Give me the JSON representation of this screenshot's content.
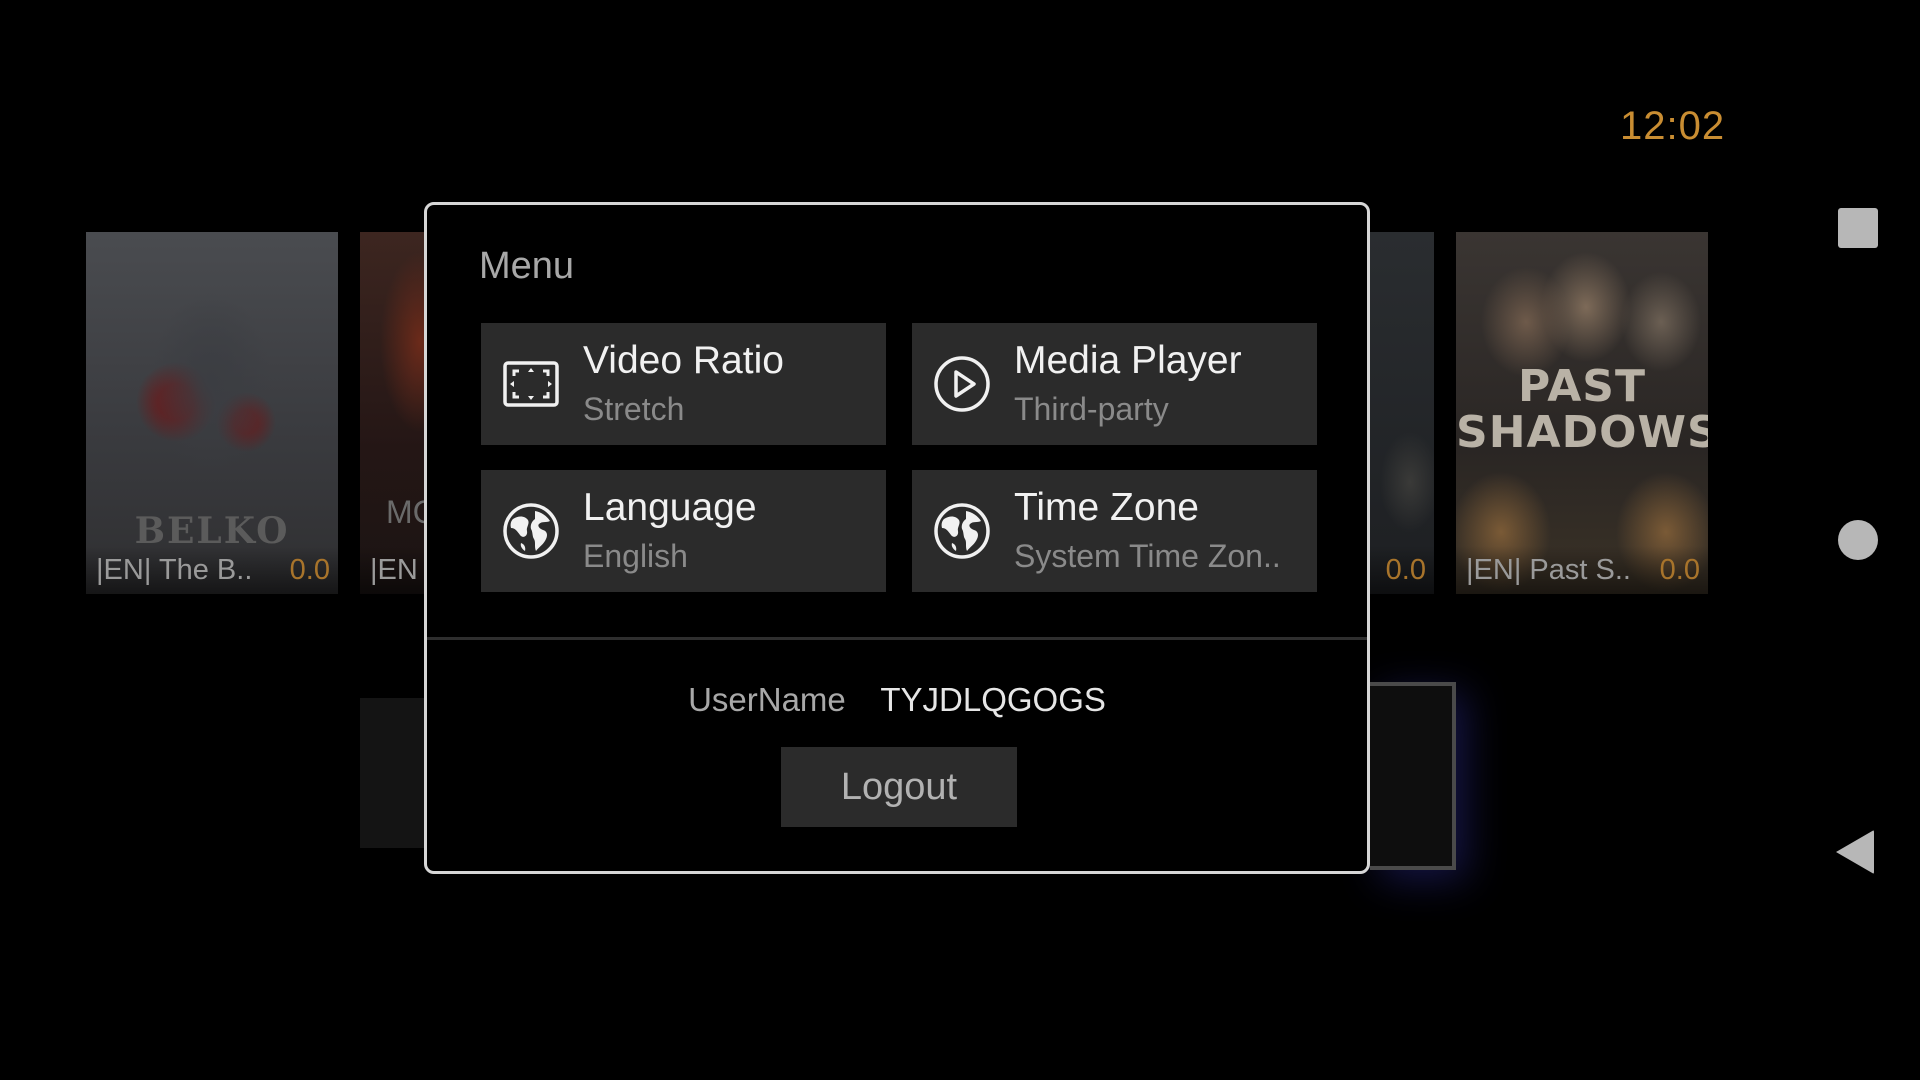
{
  "status": {
    "clock": "12:02"
  },
  "background": {
    "movies": [
      {
        "title": "|EN| The B..",
        "rating": "0.0",
        "poster_text": "BELKO"
      },
      {
        "title": "|EN",
        "rating": "",
        "poster_text": "MC"
      },
      {
        "title": "",
        "rating": "0.0",
        "poster_text": ""
      },
      {
        "title": "|EN| Past S..",
        "rating": "0.0",
        "poster_text": "PAST SHADOWS"
      }
    ]
  },
  "menu": {
    "title": "Menu",
    "options": [
      {
        "label": "Video Ratio",
        "value": "Stretch",
        "icon": "aspect-ratio-icon"
      },
      {
        "label": "Media Player",
        "value": "Third-party",
        "icon": "play-circle-icon"
      },
      {
        "label": "Language",
        "value": "English",
        "icon": "globe-icon"
      },
      {
        "label": "Time Zone",
        "value": "System Time Zon..",
        "icon": "globe-icon"
      }
    ],
    "username_label": "UserName",
    "username": "TYJDLQGOGS",
    "logout_label": "Logout"
  },
  "nav": {
    "icons": [
      "recent-apps-icon",
      "home-icon",
      "back-icon"
    ]
  },
  "colors": {
    "accent": "#c98d32",
    "tile_bg": "#2b2b2b",
    "dialog_border": "#d6d6d6"
  }
}
